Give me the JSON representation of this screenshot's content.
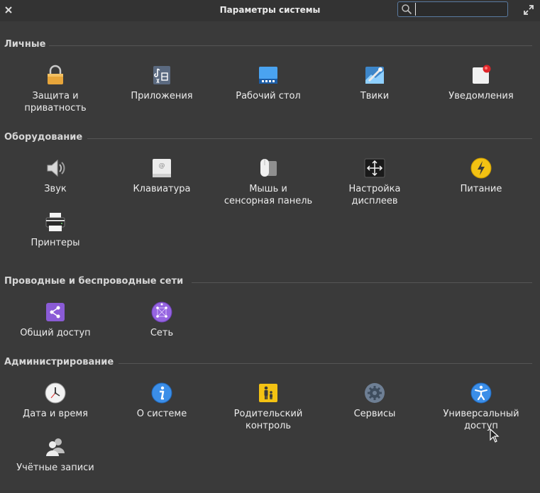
{
  "window": {
    "title": "Параметры системы",
    "search_placeholder": ""
  },
  "sections": [
    {
      "title": "Личные",
      "items": [
        {
          "label": "Защита и\nприватность",
          "icon": "lock-icon"
        },
        {
          "label": "Приложения",
          "icon": "applications-icon"
        },
        {
          "label": "Рабочий стол",
          "icon": "desktop-icon"
        },
        {
          "label": "Твики",
          "icon": "tweaks-icon"
        },
        {
          "label": "Уведомления",
          "icon": "notifications-icon"
        }
      ]
    },
    {
      "title": "Оборудование",
      "items": [
        {
          "label": "Звук",
          "icon": "sound-icon"
        },
        {
          "label": "Клавиатура",
          "icon": "keyboard-icon"
        },
        {
          "label": "Мышь и\nсенсорная панель",
          "icon": "mouse-icon"
        },
        {
          "label": "Настройка\nдисплеев",
          "icon": "display-icon"
        },
        {
          "label": "Питание",
          "icon": "power-icon"
        },
        {
          "label": "Принтеры",
          "icon": "printer-icon"
        }
      ]
    },
    {
      "title": "Проводные и беспроводные сети",
      "items": [
        {
          "label": "Общий доступ",
          "icon": "sharing-icon"
        },
        {
          "label": "Сеть",
          "icon": "network-icon"
        }
      ]
    },
    {
      "title": "Администрирование",
      "items": [
        {
          "label": "Дата и время",
          "icon": "clock-icon"
        },
        {
          "label": "О системе",
          "icon": "info-icon"
        },
        {
          "label": "Родительский\nконтроль",
          "icon": "parental-control-icon"
        },
        {
          "label": "Сервисы",
          "icon": "services-gear-icon"
        },
        {
          "label": "Универсальный\nдоступ",
          "icon": "accessibility-icon"
        },
        {
          "label": "Учётные записи",
          "icon": "users-icon"
        }
      ]
    }
  ]
}
